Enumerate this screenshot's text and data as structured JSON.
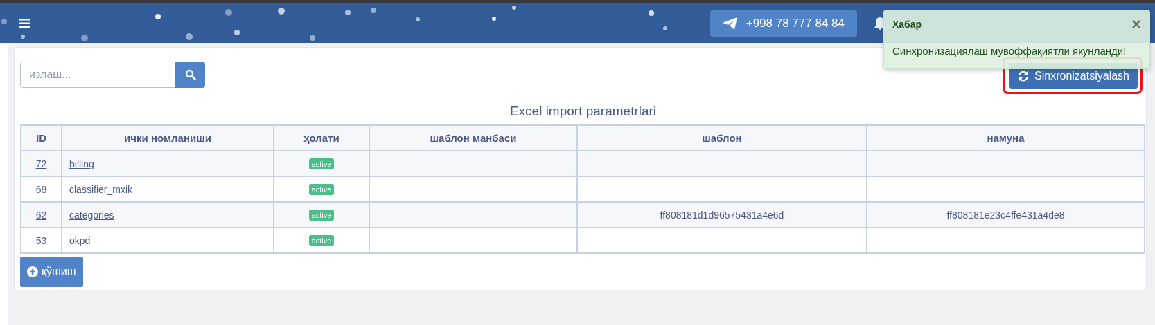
{
  "header": {
    "phone": "+998 78 777 84 84"
  },
  "toast": {
    "title": "Хабар",
    "message": "Синхронизациялаш мувоффақиятли якунланди!",
    "close": "×"
  },
  "search": {
    "placeholder": "излаш..."
  },
  "sync_button": {
    "label": "Sinxronizatsiyalash",
    "highlighted": true
  },
  "table": {
    "title": "Excel import parametrlari",
    "columns": [
      "ID",
      "ички номланиши",
      "ҳолати",
      "шаблон манбаси",
      "шаблон",
      "намуна"
    ],
    "rows": [
      {
        "id": "72",
        "name": "billing",
        "status": "active",
        "source": "",
        "template": "",
        "sample": ""
      },
      {
        "id": "68",
        "name": "classifier_mxik",
        "status": "active",
        "source": "",
        "template": "",
        "sample": ""
      },
      {
        "id": "62",
        "name": "categories",
        "status": "active",
        "source": "",
        "template": "ff808181d1d96575431a4e6d",
        "sample": "ff808181e23c4ffe431a4de8"
      },
      {
        "id": "53",
        "name": "okpd",
        "status": "active",
        "source": "",
        "template": "",
        "sample": ""
      }
    ]
  },
  "add_button": {
    "label": "қўшиш"
  }
}
